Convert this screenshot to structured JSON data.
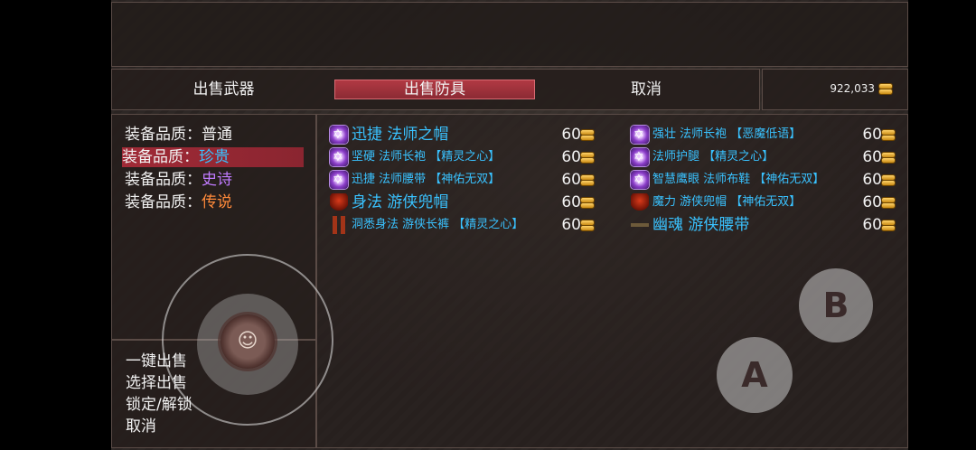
{
  "tabs": {
    "sell_weapons": "出售武器",
    "sell_armor": "出售防具",
    "cancel": "取消"
  },
  "gold": {
    "amount": "922,033"
  },
  "quality_filter": [
    {
      "label": "装备品质",
      "sep": "：",
      "value": "普通",
      "color": "#f2f2f2",
      "selected": false
    },
    {
      "label": "装备品质",
      "sep": "：",
      "value": "珍贵",
      "color": "#39c2ff",
      "selected": true
    },
    {
      "label": "装备品质",
      "sep": "：",
      "value": "史诗",
      "color": "#c07bff",
      "selected": false
    },
    {
      "label": "装备品质",
      "sep": "：",
      "value": "传说",
      "color": "#ff8a3a",
      "selected": false
    }
  ],
  "commands": [
    "一键出售",
    "选择出售",
    "锁定/解锁",
    "取消"
  ],
  "items_left": [
    {
      "name": "迅捷 法师之帽",
      "price": "60",
      "icon": "rune-icon"
    },
    {
      "name": "坚硬 法师长袍 【精灵之心】",
      "price": "60",
      "icon": "rune-icon"
    },
    {
      "name": "迅捷 法师腰带 【神佑无双】",
      "price": "60",
      "icon": "rune-icon"
    },
    {
      "name": "身法 游侠兜帽",
      "price": "60",
      "icon": "hood-icon"
    },
    {
      "name": "洞悉身法 游侠长裤 【精灵之心】",
      "price": "60",
      "icon": "legs-icon"
    }
  ],
  "items_right": [
    {
      "name": "强壮 法师长袍 【恶魔低语】",
      "price": "60",
      "icon": "rune-icon"
    },
    {
      "name": "法师护腿 【精灵之心】",
      "price": "60",
      "icon": "rune-icon"
    },
    {
      "name": "智慧鹰眼 法师布鞋 【神佑无双】",
      "price": "60",
      "icon": "rune-icon"
    },
    {
      "name": "魔力 游侠兜帽 【神佑无双】",
      "price": "60",
      "icon": "hood-icon"
    },
    {
      "name": "幽魂 游侠腰带",
      "price": "60",
      "icon": "belt-icon"
    }
  ],
  "buttons": {
    "a": "A",
    "b": "B"
  }
}
